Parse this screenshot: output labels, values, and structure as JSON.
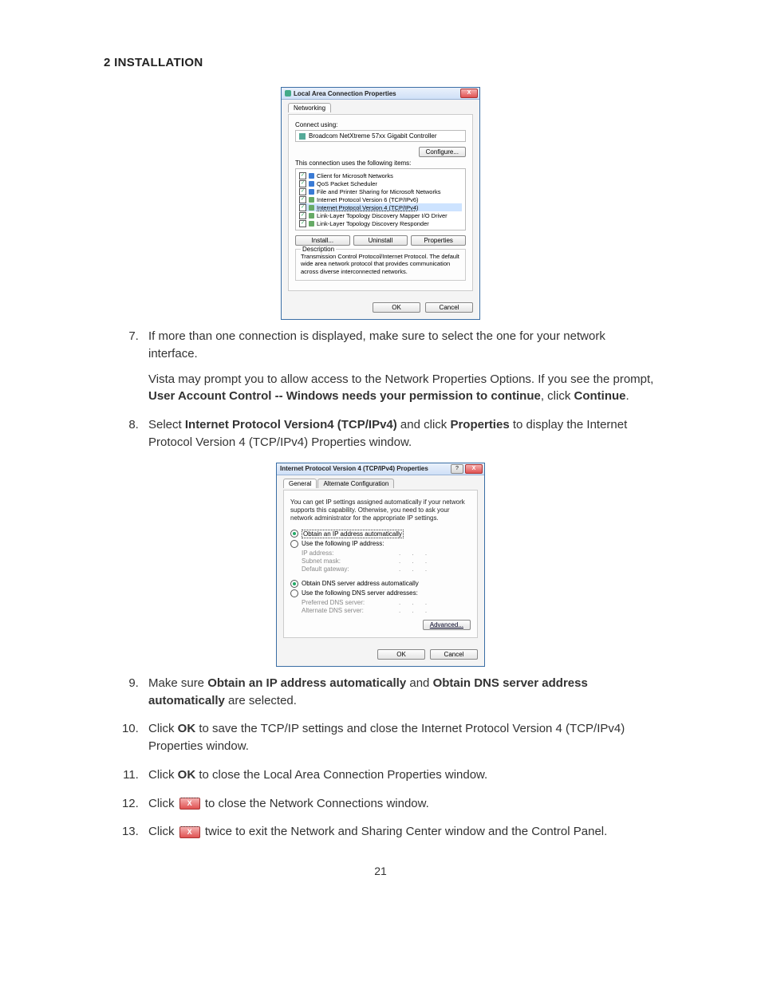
{
  "section_heading": "2 INSTALLATION",
  "page_number": "21",
  "dialog1": {
    "title": "Local Area Connection Properties",
    "close_x": "X",
    "tab_networking": "Networking",
    "connect_using_label": "Connect using:",
    "adapter": "Broadcom NetXtreme 57xx Gigabit Controller",
    "configure_btn": "Configure...",
    "uses_items_label": "This connection uses the following items:",
    "items": [
      "Client for Microsoft Networks",
      "QoS Packet Scheduler",
      "File and Printer Sharing for Microsoft Networks",
      "Internet Protocol Version 6 (TCP/IPv6)",
      "Internet Protocol Version 4 (TCP/IPv4)",
      "Link-Layer Topology Discovery Mapper I/O Driver",
      "Link-Layer Topology Discovery Responder"
    ],
    "install_btn": "Install...",
    "uninstall_btn": "Uninstall",
    "properties_btn": "Properties",
    "desc_label": "Description",
    "desc_text": "Transmission Control Protocol/Internet Protocol. The default wide area network protocol that provides communication across diverse interconnected networks.",
    "ok_btn": "OK",
    "cancel_btn": "Cancel"
  },
  "dialog2": {
    "title": "Internet Protocol Version 4 (TCP/IPv4) Properties",
    "help_q": "?",
    "close_x": "X",
    "tab_general": "General",
    "tab_alt": "Alternate Configuration",
    "note": "You can get IP settings assigned automatically if your network supports this capability. Otherwise, you need to ask your network administrator for the appropriate IP settings.",
    "radio_auto_ip": "Obtain an IP address automatically",
    "radio_manual_ip": "Use the following IP address:",
    "ip_label": "IP address:",
    "subnet_label": "Subnet mask:",
    "gateway_label": "Default gateway:",
    "radio_auto_dns": "Obtain DNS server address automatically",
    "radio_manual_dns": "Use the following DNS server addresses:",
    "pref_dns": "Preferred DNS server:",
    "alt_dns": "Alternate DNS server:",
    "advanced_btn": "Advanced...",
    "ok_btn": "OK",
    "cancel_btn": "Cancel",
    "dots": ".  .  ."
  },
  "steps": {
    "s7a": "If more than one connection is displayed, make sure to select the one for your network interface.",
    "s7b_pre": "Vista may prompt you to allow access to the Network Properties Options. If you see the prompt, ",
    "s7b_bold": "User Account Control -- Windows needs your permission to continue",
    "s7b_mid": ", click ",
    "s7b_continue": "Continue",
    "s7b_post": ".",
    "s8_pre": "Select ",
    "s8_b1": "Internet Protocol Version4 (TCP/IPv4)",
    "s8_mid": " and click ",
    "s8_b2": "Properties",
    "s8_post": " to display the Internet Protocol Version 4 (TCP/IPv4) Properties window.",
    "s9_pre": "Make sure ",
    "s9_b1": "Obtain an IP address automatically",
    "s9_mid": " and ",
    "s9_b2": "Obtain DNS server address automatically",
    "s9_post": " are selected.",
    "s10_pre": "Click ",
    "s10_b": "OK",
    "s10_post": " to save the TCP/IP settings and close the Internet Protocol Version 4 (TCP/IPv4) Properties window.",
    "s11_pre": "Click ",
    "s11_b": "OK",
    "s11_post": " to close the Local Area Connection Properties window.",
    "s12_pre": "Click ",
    "s12_post": " to close the Network Connections window.",
    "s13_pre": "Click ",
    "s13_post": " twice to exit the Network and Sharing Center window and the Control Panel.",
    "close_glyph": "X"
  }
}
